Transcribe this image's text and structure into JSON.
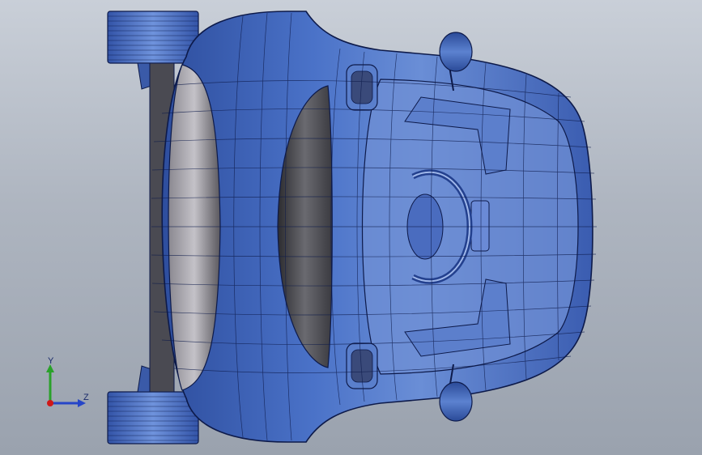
{
  "viewport": {
    "background_top": "#c9cfd8",
    "background_bottom": "#9aa2ae"
  },
  "model": {
    "body_color": "#3f63b8",
    "body_dark": "#1e3a85",
    "edge_color": "#0d1a4a",
    "glass_color": "#5a5a60",
    "tire_color": "#4a6fc4"
  },
  "triad": {
    "y_label": "Y",
    "z_label": "Z",
    "y_color": "#2aa12a",
    "z_color": "#2646c8",
    "x_color": "#d01818"
  }
}
